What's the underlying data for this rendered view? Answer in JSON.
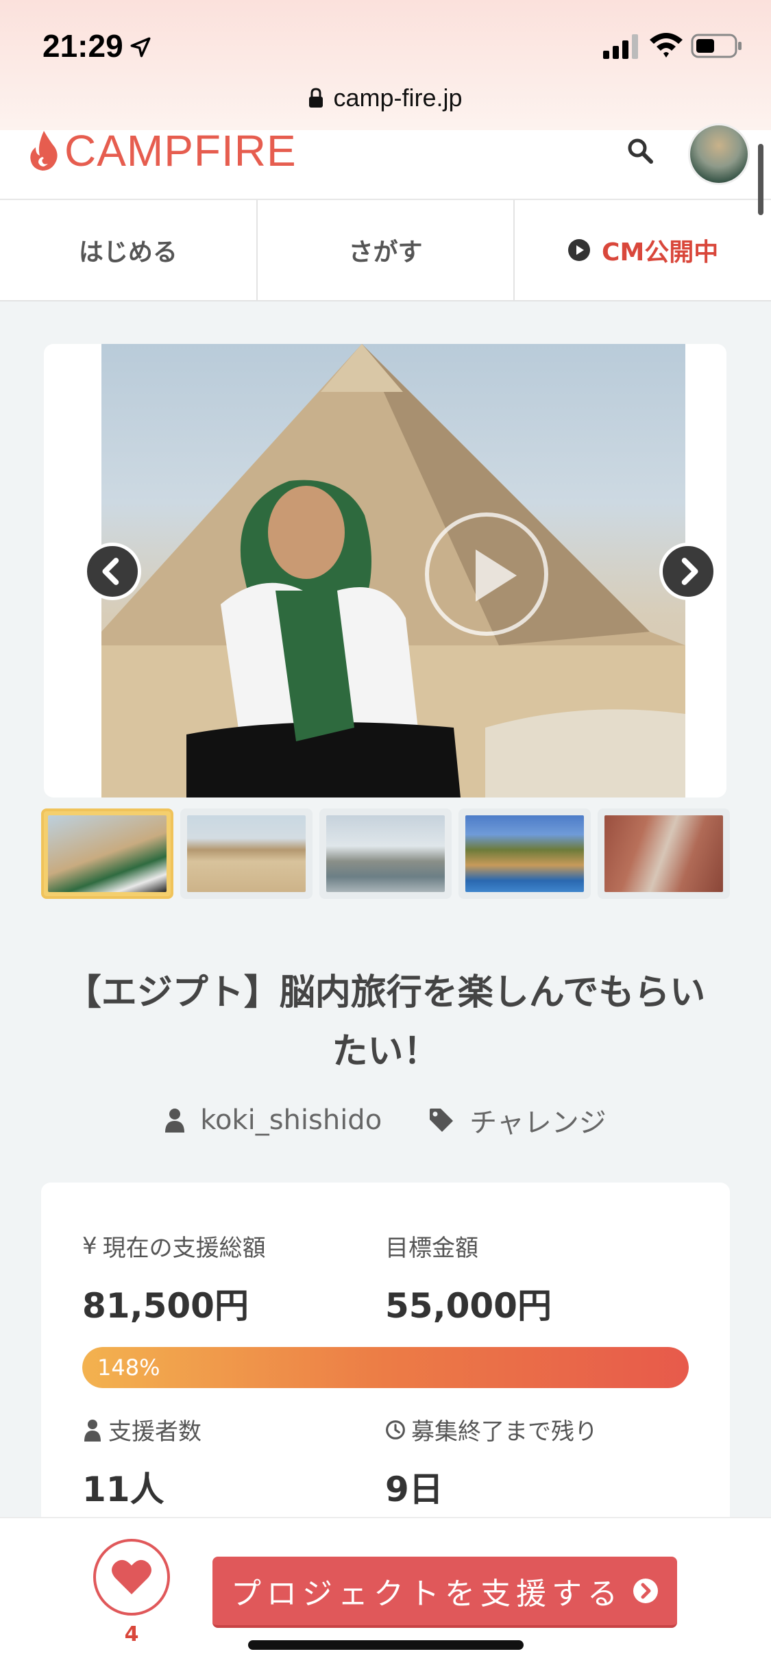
{
  "status_bar": {
    "time": "21:29",
    "url": "camp-fire.jp"
  },
  "header": {
    "logo_text": "CAMPFIRE",
    "accent_color": "#e65d4f"
  },
  "nav": {
    "items": [
      {
        "label": "はじめる"
      },
      {
        "label": "さがす"
      },
      {
        "label": "CM公開中"
      }
    ]
  },
  "gallery": {
    "thumbnails": [
      "pyramid-portrait",
      "pyramids-desert",
      "bridge-towers",
      "palm-resort",
      "rock-canyon"
    ],
    "active_index": 0
  },
  "project": {
    "title": "【エジプト】脳内旅行を楽しんでもらいたい！",
    "author": "koki_shishido",
    "category": "チャレンジ"
  },
  "stats": {
    "current_label": "現在の支援総額",
    "current_value": "81,500円",
    "goal_label": "目標金額",
    "goal_value": "55,000円",
    "progress_percent": 148,
    "progress_text": "148%",
    "backers_label": "支援者数",
    "backers_value": "11人",
    "remaining_label": "募集終了まで残り",
    "remaining_value": "9日",
    "currency_symbol": "¥"
  },
  "actions": {
    "favorite_count": "4",
    "support_label": "プロジェクトを支援する"
  }
}
